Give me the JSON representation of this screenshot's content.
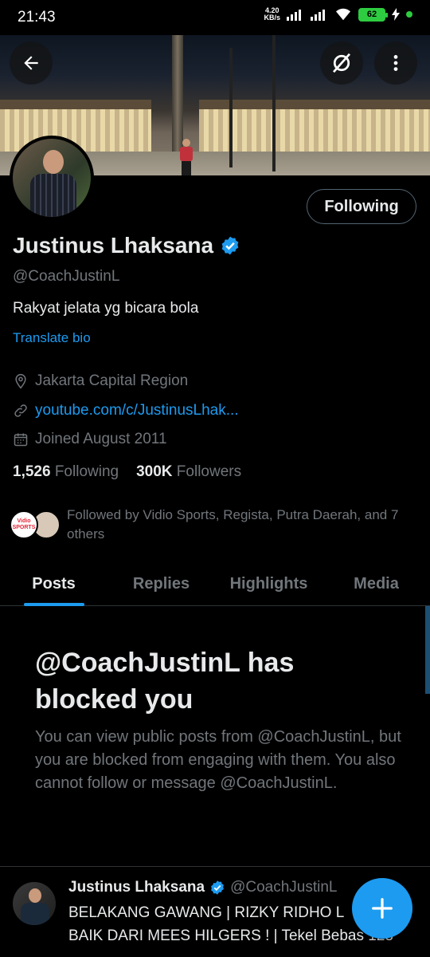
{
  "status_bar": {
    "time": "21:43",
    "net_speed_value": "4.20",
    "net_speed_unit": "KB/s",
    "battery": "62"
  },
  "header": {
    "back_icon": "arrow-left-icon",
    "grok_icon": "grok-icon",
    "more_icon": "more-vertical-icon"
  },
  "profile": {
    "follow_button_label": "Following",
    "display_name": "Justinus Lhaksana",
    "handle": "@CoachJustinL",
    "bio": "Rakyat jelata yg bicara bola",
    "translate_label": "Translate bio",
    "location": "Jakarta Capital Region",
    "website": "youtube.com/c/JustinusLhak...",
    "joined": "Joined August 2011",
    "following_count": "1,526",
    "following_label": "Following",
    "followers_count": "300K",
    "followers_label": "Followers",
    "followed_by": "Followed by Vidio Sports, Regista, Putra Daerah, and 7 others",
    "followed_avatar_1_text": "Vidio SPORTS",
    "accent_color": "#1d9bf0"
  },
  "tabs": [
    {
      "label": "Posts",
      "active": true
    },
    {
      "label": "Replies",
      "active": false
    },
    {
      "label": "Highlights",
      "active": false
    },
    {
      "label": "Media",
      "active": false
    }
  ],
  "blocked": {
    "title": "@CoachJustinL has blocked you",
    "body": "You can view public posts from @CoachJustinL, but you are blocked from engaging with them. You also cannot follow or message @CoachJustinL."
  },
  "post": {
    "name": "Justinus Lhaksana",
    "handle": "@CoachJustinL",
    "text": "BELAKANG GAWANG | RIZKY RIDHO L\nBAIK DARI MEES HILGERS ! | Tekel Bebas 128"
  },
  "fab": {
    "icon": "plus-icon"
  }
}
